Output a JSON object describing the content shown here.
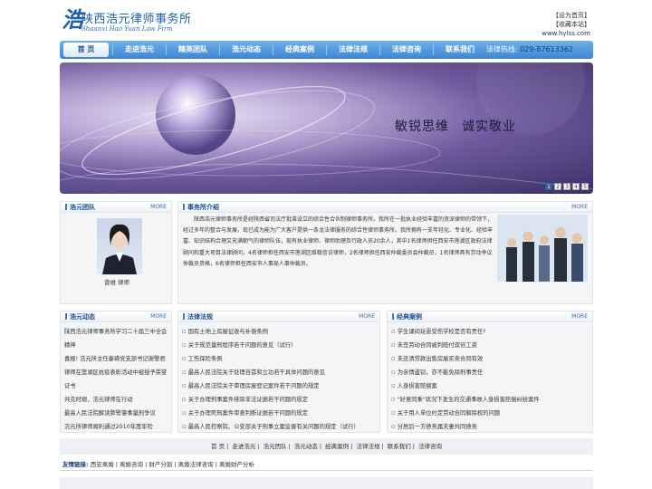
{
  "header": {
    "logo_glyph": "浩",
    "logo_name": "陕西浩元律师事务所",
    "logo_english": "Shaanxi Hao Yuan Law Firm",
    "set_home": "【设为首页】",
    "bookmark": "【收藏本站】",
    "site_url": "www.hylss.com"
  },
  "nav": {
    "items": [
      "首 页",
      "走进浩元",
      "精英团队",
      "浩元动态",
      "经典案例",
      "法律法规",
      "法律咨询",
      "联系我们"
    ],
    "active_index": 0,
    "hotline_label": "法律热线:",
    "hotline_number": "029-87613362"
  },
  "banner": {
    "slogan_1": "敏锐思维",
    "slogan_2": "诚实敬业",
    "pages": [
      "1",
      "2",
      "3",
      "4",
      "5"
    ],
    "active_page": 0
  },
  "team": {
    "title": "浩元团队",
    "more": "MORE",
    "caption": "曾维 律师"
  },
  "intro": {
    "title": "事务所介绍",
    "more": "MORE",
    "text": "陕西浩元律师事务所是经陕西省司法厅批准设立的综合性合伙制律师事务所。我所在一批执业经验丰富的资深律师的带领下，经过多年的整合与发展，现已成为能为广大客户提供一条龙法律服务的综合性律师事务所。我所拥有一支年轻化、专业化、经验丰富、知识结构合理又充满朝气的律师队伍，现有执业律师、律师助理及行政人员20余人，其中1名律师担任西安市莲湖区政府法律顾问和重大项目法律顾问，4名律师担任西安市莲湖区维稳信访律师，2名律师担任西安仲裁委员会仲裁员，1名律师具有劳动争议仲裁员资格，6名律师担任西安市人事局人事仲裁员。"
  },
  "news": {
    "title": "浩元动态",
    "more": "MORE",
    "items": [
      "陕西浩元律师事务所学习二十届三中全会精神",
      "喜报! 浩元所主任秦瑛党支部书记谢警君律师在莲湖区抗疫表彰活动中被授予荣誉证书",
      "共克时艰，浩元律师在行动",
      "最高人民法院解读肺警肇事量刑争议",
      "浩元所律师顺利通过2010年度年检"
    ]
  },
  "laws": {
    "title": "法律法规",
    "more": "MORE",
    "items": [
      "国有土地上房屋征收与补偿条例",
      "关于规范量刑程序若干问题的意见（试行）",
      "工伤保险条例",
      "最高人民法院关于处理自首和立功若干具体问题的意见",
      "最高人民法院关于审理房屋登记案件若干问题的规定",
      "关于办理刑事案件排除非法证据若干问题的规定",
      "关于办理死刑案件审查判断证据若干问题的规定",
      "最高人民检察院、公安部关于刑事立案监督有关问题的规定（试行）"
    ]
  },
  "cases": {
    "title": "经典案例",
    "more": "MORE",
    "items": [
      "学生课间玩耍受伤学校是否有责任?",
      "未签劳动合同被判赔付双倍工资",
      "未还清贷款出售房屋买卖合同有效",
      "为亲情盗窃，亦不能免除刑事责任",
      "人身损害赔偿案",
      "\"好意同乘\"状况下发生的交通事故人身损害赔偿纠纷案件",
      "关于用人单位约定劳动合同解除权的问题",
      "分居后一方债务属夫妻共同债务"
    ]
  },
  "footer": {
    "links": [
      "首 页",
      "走进浩元",
      "浩元团队",
      "浩元动态",
      "经典案例",
      "法律法规",
      "联系我们",
      "法律咨询"
    ],
    "friends_label": "友情链接:",
    "friends": [
      "西安离婚",
      "离婚咨询",
      "财产分割",
      "离婚法律咨询",
      "离婚财产分析"
    ]
  }
}
